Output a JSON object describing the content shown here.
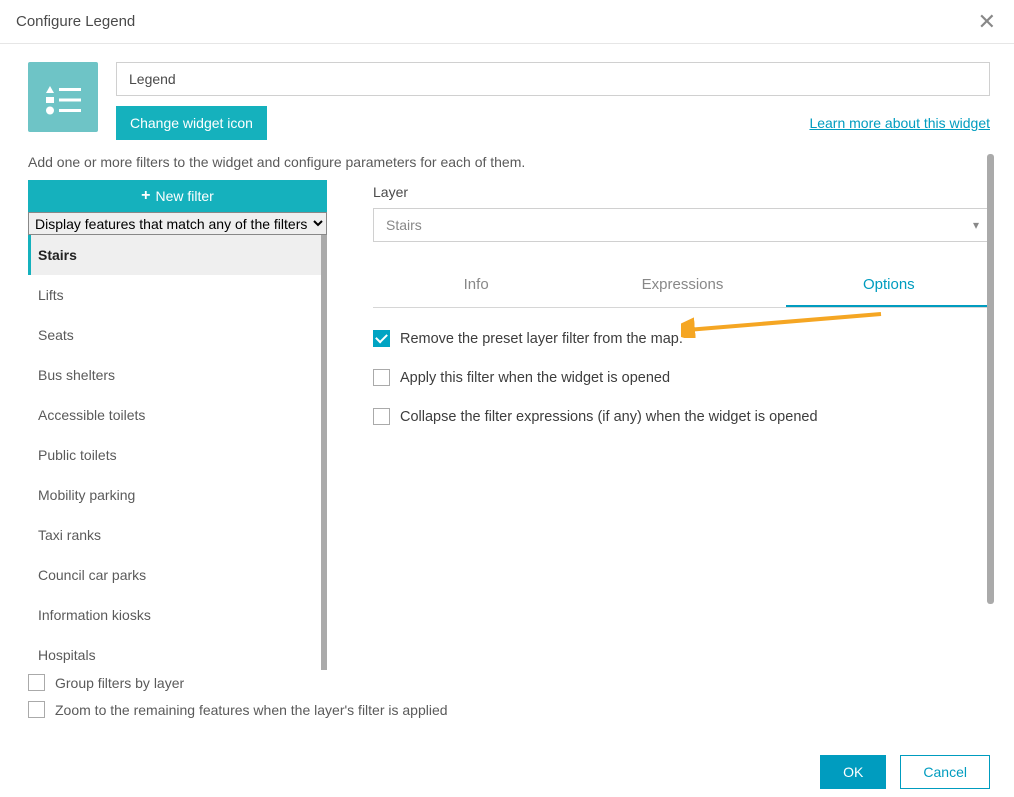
{
  "header": {
    "title": "Configure Legend"
  },
  "widget": {
    "name": "Legend",
    "change_icon": "Change widget icon",
    "learn_more": "Learn more about this widget"
  },
  "description": "Add one or more filters to the widget and configure parameters for each of them.",
  "left": {
    "new_filter": "New filter",
    "match_mode": "Display features that match any of the filters",
    "filters": [
      "Stairs",
      "Lifts",
      "Seats",
      "Bus shelters",
      "Accessible toilets",
      "Public toilets",
      "Mobility parking",
      "Taxi ranks",
      "Council car parks",
      "Information kiosks",
      "Hospitals"
    ],
    "selected": 0
  },
  "right": {
    "layer_label": "Layer",
    "layer_value": "Stairs",
    "tabs": [
      "Info",
      "Expressions",
      "Options"
    ],
    "active_tab": 2,
    "options": [
      {
        "label": "Remove the preset layer filter from the map.",
        "checked": true
      },
      {
        "label": "Apply this filter when the widget is opened",
        "checked": false
      },
      {
        "label": "Collapse the filter expressions (if any) when the widget is opened",
        "checked": false
      }
    ]
  },
  "bottom": {
    "group": "Group filters by layer",
    "zoom": "Zoom to the remaining features when the layer's filter is applied"
  },
  "footer": {
    "ok": "OK",
    "cancel": "Cancel"
  }
}
